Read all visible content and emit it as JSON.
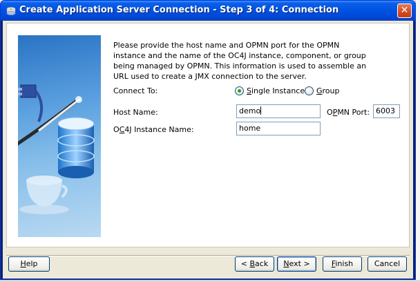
{
  "window": {
    "title": "Create Application Server Connection - Step 3 of 4: Connection",
    "close_glyph": "✕"
  },
  "intro": "Please provide the host name and OPMN port for the OPMN instance and the name of the OC4J instance, component, or group being managed by OPMN. This information is used to assemble an URL used to create a JMX connection to the server.",
  "connect_to": {
    "label": "Connect To:",
    "options": [
      {
        "label_mnemonic": "S",
        "label_rest": "ingle Instance",
        "checked": true
      },
      {
        "label_mnemonic": "G",
        "label_rest": "roup",
        "checked": false
      }
    ]
  },
  "host": {
    "label": "Host Name:",
    "value": "demo"
  },
  "opmn_port": {
    "label_pre": "O",
    "label_mnemonic": "P",
    "label_rest": "MN Port:",
    "value": "6003"
  },
  "oc4j": {
    "label_pre": "O",
    "label_mnemonic": "C",
    "label_rest": "4J Instance Name:",
    "value": "home"
  },
  "buttons": {
    "help": {
      "mnemonic": "H",
      "rest": "elp"
    },
    "back": {
      "pre": "< ",
      "mnemonic": "B",
      "rest": "ack"
    },
    "next": {
      "mnemonic": "N",
      "rest": "ext >"
    },
    "finish": {
      "mnemonic": "F",
      "rest": "inish"
    },
    "cancel": {
      "label": "Cancel"
    }
  },
  "icons": {
    "title": "app-server-icon",
    "art": "database-illustration"
  },
  "colors": {
    "titlebar": "#0054e3",
    "panel": "#ece9d8",
    "radio_checked": "#21a121",
    "close": "#d34a1f"
  }
}
